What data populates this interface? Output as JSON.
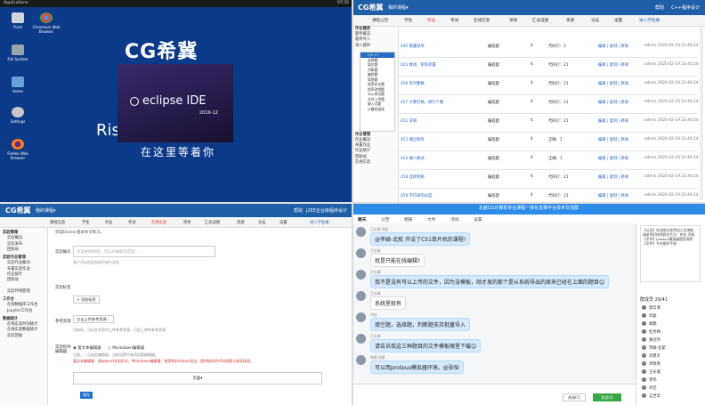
{
  "desktop": {
    "menu": "Applications",
    "clock": "07:35",
    "icons": [
      {
        "label": "Trash"
      },
      {
        "label": "Chromium Web Browser"
      },
      {
        "label": "File System"
      },
      {
        "label": "Home"
      },
      {
        "label": "Settings"
      },
      {
        "label": "Firefox Web Browser"
      }
    ],
    "splash_logo": "CG希冀",
    "splash_rise": "Rise                    you",
    "splash_cn": "在这里等着你",
    "eclipse_name": "eclipse IDE",
    "eclipse_version": "2019-12"
  },
  "admin": {
    "brand": "CG希冀",
    "menu": "我的课程▾",
    "help": "帮助",
    "user": "C++程序设计",
    "tabs": [
      "课程公告",
      "学生",
      "作业",
      "考试",
      "在线实验",
      "项目",
      "汇总成绩",
      "资源",
      "论坛",
      "设置",
      "进入学生端"
    ],
    "sidebar": [
      "作业题库",
      "题目概览",
      "题目导入",
      "进入题目",
      "作业管理",
      "作业概况",
      "布置作业",
      "作业统计",
      "回收站",
      "在线实验"
    ],
    "tree": [
      "C/C++",
      "选择题",
      "填空题",
      "判断题",
      "编程题",
      "简答题",
      "程序补全题",
      "程序改错题",
      "SQL测试题",
      "文件上传题",
      "嵌入式题",
      "计算机组成"
    ],
    "rows": [
      {
        "title": "440 数量排序",
        "type": "编程题",
        "score": "4",
        "cat": "代码行：2",
        "edit": "编辑 | 复制 | 移除",
        "date": "admin 2020-02-19 23:40:24"
      },
      {
        "title": "443 数组、矩阵转置",
        "type": "编程题",
        "score": "4",
        "cat": "代码行：21",
        "edit": "编辑 | 复制 | 移除",
        "date": "admin 2020-02-19 23:40:24"
      },
      {
        "title": "456 阵列整数",
        "type": "编程题",
        "score": "4",
        "cat": "代码行：21",
        "edit": "编辑 | 复制 | 移除",
        "date": "admin 2020-02-19 23:40:24"
      },
      {
        "title": "457 计算空格、换行个数",
        "type": "编程题",
        "score": "4",
        "cat": "代码行：21",
        "edit": "编辑 | 复制 | 移除",
        "date": "admin 2020-02-19 23:40:24"
      },
      {
        "title": "455 求和",
        "type": "编程题",
        "score": "4",
        "cat": "代码行：21",
        "edit": "编辑 | 复制 | 移除",
        "date": "admin 2020-02-19 23:40:24"
      },
      {
        "title": "453 输出矩阵",
        "type": "编程题",
        "score": "4",
        "cat": "正确：1",
        "edit": "编辑 | 复制 | 移除",
        "date": "admin 2020-02-19 23:40:24"
      },
      {
        "title": "454 输入数式",
        "type": "编程题",
        "score": "4",
        "cat": "正确：1",
        "edit": "编辑 | 复制 | 移除",
        "date": "admin 2020-02-19 23:40:24"
      },
      {
        "title": "458 选择判断",
        "type": "编程题",
        "score": "4",
        "cat": "代码行：21",
        "edit": "编辑 | 复制 | 移除",
        "date": "admin 2020-02-19 23:40:24"
      },
      {
        "title": "459 字符串的长度",
        "type": "编程题",
        "score": "4",
        "cat": "代码行：21",
        "edit": "编辑 | 复制 | 移除",
        "date": "admin 2020-02-19 23:40:24"
      }
    ]
  },
  "form": {
    "brand": "CG希冀",
    "menu": "我的课程▾",
    "help": "帮助",
    "user": "J2EE企业级程序设计",
    "tabs": [
      "课程信息",
      "学生",
      "作业",
      "考试",
      "在线实验",
      "项目",
      "汇总成绩",
      "资源",
      "论坛",
      "设置",
      "进入学生端"
    ],
    "sidebar_groups": [
      {
        "head": "实验管理",
        "items": [
          "实验概况",
          "实验发布",
          "回收站"
        ]
      },
      {
        "head": "实验作业管理",
        "items": [
          "实验作业概况",
          "布置实验作业",
          "作业统计",
          "回收站"
        ]
      },
      {
        "head": "",
        "items": [
          "实验环境管理"
        ]
      },
      {
        "head": "工作台",
        "items": [
          "在线数据库工作台",
          "Jupyter工作台"
        ]
      },
      {
        "head": "数据统计",
        "items": [
          "在线实验时间统计",
          "在线实验数据统计",
          "实验回收"
        ]
      }
    ],
    "intro": "完成Docker基本命令练习。",
    "field_name_label": "实验编号",
    "field_name_placeholder": "点击右侧按钮，可以开展新的实验...",
    "field_name_hint": "用户可以在此实验中进行实验",
    "tags_label": "实验标签",
    "add_tag": "+ 添加标签",
    "ref_label": "参考资源",
    "upload_btn": "点击上传参考资源...",
    "ref_hint": "可选项，可以在实验中上传参考资源，已经上传的参考资源",
    "editor_label": "实验指导 编辑器",
    "editor_opt1": "富文本编辑器",
    "editor_opt2": "Markdown编辑器",
    "editor_hint": "注意，一旦选定编辑器，当前设置不能再切换编辑器。",
    "editor_hint2": "富文本编辑器：类似word文档形式，Markdown编辑器：使用Markdown语法，提供较好的代码排版与阅读体验。",
    "insert": "页面▾",
    "save": "保存"
  },
  "chat": {
    "title": "北航CG计算机专业课程一体化支撑平台技术交流群",
    "tabs": [
      "聊天",
      "公告",
      "相册",
      "文件",
      "活动",
      "设置"
    ],
    "messages": [
      {
        "name": "王长城 北航",
        "text": "@李颖-北航 开设了C51单片机的课程!",
        "blue": true
      },
      {
        "name": "王长城",
        "text": "就是只能在线编辑?",
        "blue": false
      },
      {
        "name": "王长城",
        "text": "我不是没有可以上传的文件，因为没模板，刚才发的那个是从系统导出的原来已经在上面的题目😊",
        "blue": true
      },
      {
        "name": "王长城",
        "text": "系统里就有",
        "blue": false
      },
      {
        "name": "刘佳",
        "text": "填空题，选择题，判断题支持批量导入",
        "blue": true
      },
      {
        "name": "王长城",
        "text": "请告诉我这三种题目的文件模板哪里下载😊",
        "blue": true
      },
      {
        "name": "李颖-北航",
        "text": "可以用proteus模拟器环境。@张怡",
        "blue": true
      }
    ],
    "close": "关闭(C)",
    "send": "发送(S)",
    "notice": "【公告】欢迎各位老师加入交流群，请老师们修改群名片为：姓名-学校【文件】proteus模拟器使用说明【文件】平台操作手册",
    "members_title": "群成员 29/41",
    "members": [
      "邵云清",
      "刘磊",
      "章鹏",
      "杜秀梅",
      "黄冠伟",
      "李颖-北航",
      "刘建军",
      "李晓燕",
      "王长城",
      "李伟",
      "刘佳",
      "孟世华"
    ]
  }
}
